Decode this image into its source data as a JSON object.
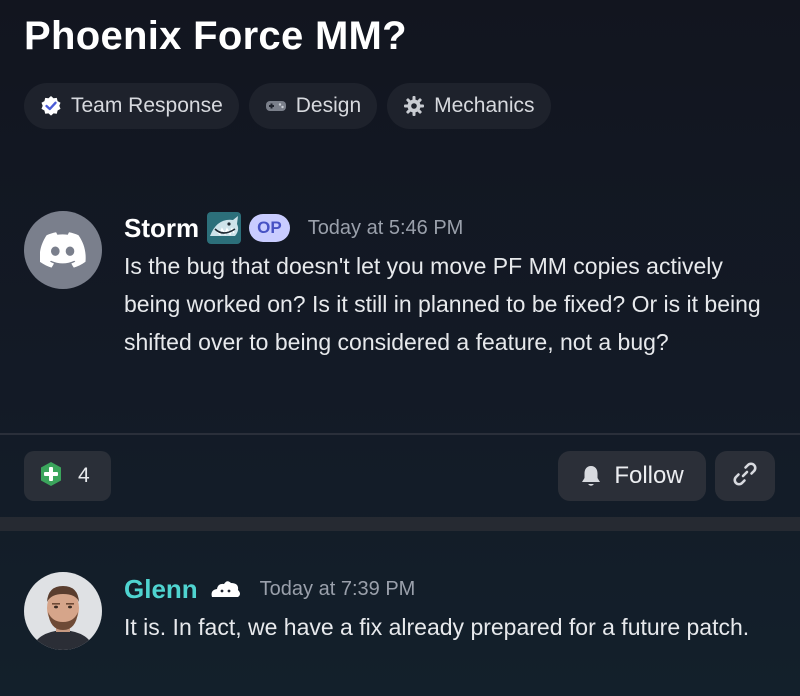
{
  "thread": {
    "title": "Phoenix Force MM?",
    "tags": [
      {
        "label": "Team Response",
        "icon": "check-badge-icon"
      },
      {
        "label": "Design",
        "icon": "gamepad-icon"
      },
      {
        "label": "Mechanics",
        "icon": "gear-icon"
      }
    ]
  },
  "original_post": {
    "author": "Storm",
    "badge": "OP",
    "time": "Today at 5:46 PM",
    "text": "Is the bug that doesn't let you move PF MM copies actively being worked on? Is it still in planned to be fixed? Or is it being shifted over to being considered a feature, not a bug?"
  },
  "reactions": {
    "emoji": "green-plus-icon",
    "count": "4"
  },
  "actions": {
    "follow_label": "Follow",
    "link_icon": "link-icon"
  },
  "reply": {
    "author": "Glenn",
    "time": "Today at 7:39 PM",
    "text": "It is. In fact, we have a fix already prepared for a future patch."
  },
  "colors": {
    "background": "#13192a",
    "op_badge_bg": "#c9ccff",
    "op_badge_text": "#4752c4",
    "reply_author": "#4fd4d0",
    "reaction_green": "#3ba55c"
  }
}
